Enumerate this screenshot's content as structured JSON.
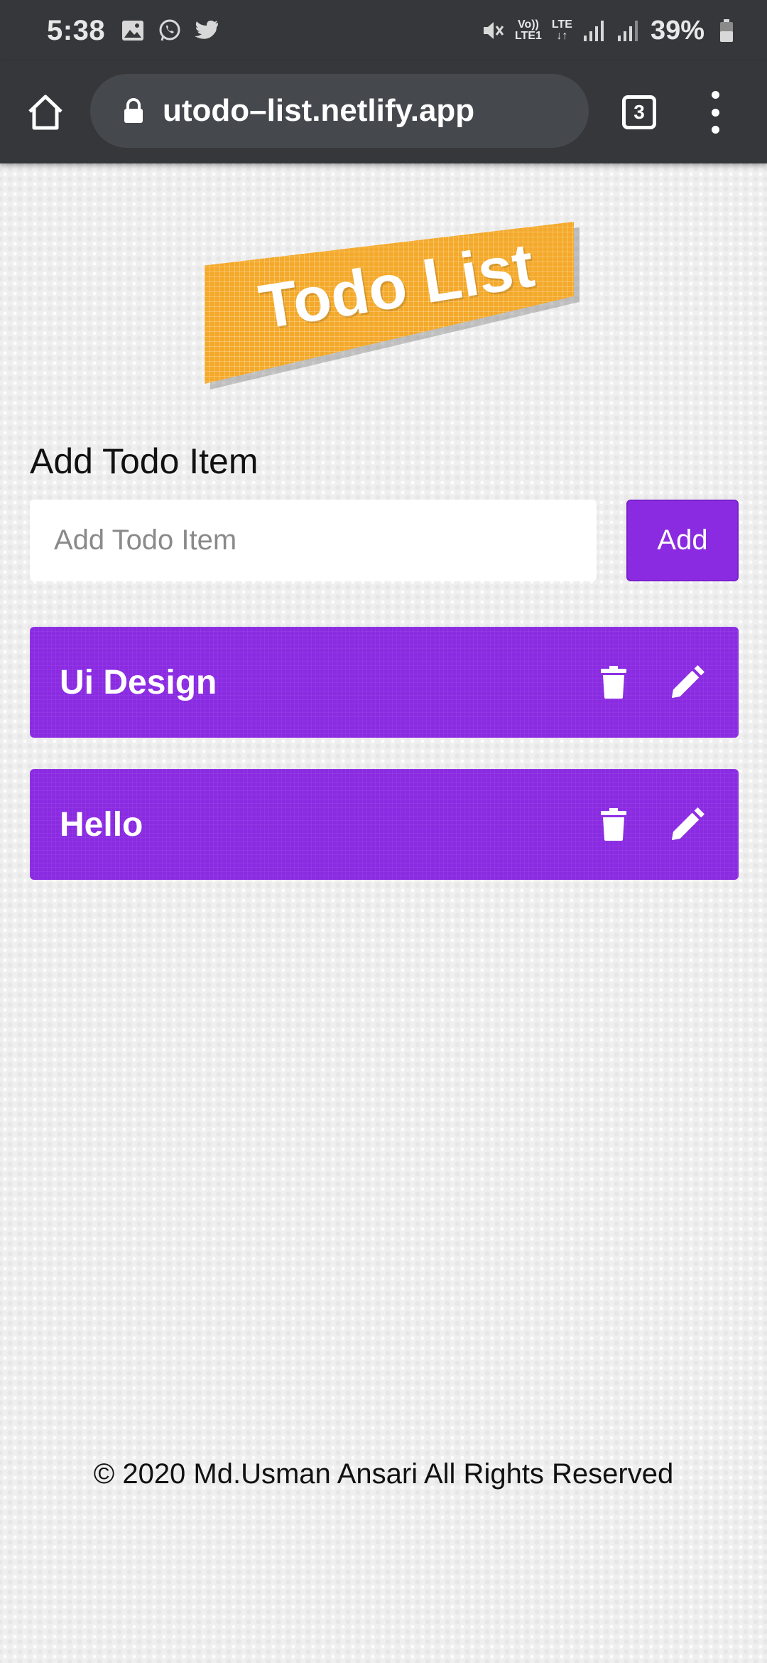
{
  "status_bar": {
    "time": "5:38",
    "network_label_top": "Vo))",
    "network_label_bottom": "LTE1",
    "lte_label": "LTE",
    "battery": "39%"
  },
  "browser": {
    "url": "utodo–list.netlify.app",
    "tab_count": "3"
  },
  "banner": {
    "title": "Todo List",
    "color": "#f4a92a"
  },
  "form": {
    "label": "Add Todo Item",
    "input_placeholder": "Add Todo Item",
    "input_value": "",
    "add_label": "Add"
  },
  "todos": [
    {
      "text": "Ui Design",
      "delete_icon": "trash-icon",
      "edit_icon": "pencil-icon"
    },
    {
      "text": "Hello",
      "delete_icon": "trash-icon",
      "edit_icon": "pencil-icon"
    }
  ],
  "colors": {
    "accent": "#8a2be2",
    "chrome": "#35373b",
    "urlbox": "#45484c"
  },
  "footer": {
    "text": "© 2020 Md.Usman Ansari All Rights Reserved"
  }
}
